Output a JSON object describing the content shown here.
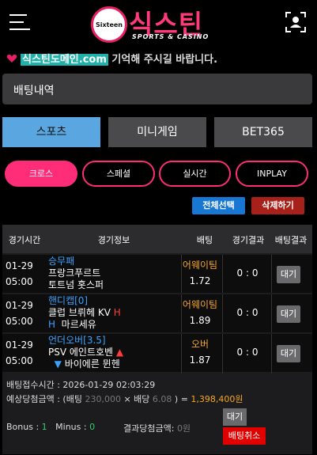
{
  "header": {
    "logo_circle_text": "Sixteen",
    "logo_main": "식스틴",
    "logo_sub": "SPORTS & CASINO"
  },
  "notice": {
    "domain": "식스틴도메인.com",
    "text": " 기억해 주시길 바랍니다."
  },
  "page_title": "배팅내역",
  "tabs": [
    {
      "label": "스포츠"
    },
    {
      "label": "미니게임"
    },
    {
      "label": "BET365"
    }
  ],
  "filters": [
    {
      "label": "크로스"
    },
    {
      "label": "스페셜"
    },
    {
      "label": "실시간"
    },
    {
      "label": "INPLAY"
    }
  ],
  "actions": {
    "select_all": "전체선택",
    "delete": "삭제하기"
  },
  "table": {
    "headers": [
      "경기시간",
      "경기정보",
      "배팅",
      "경기결과",
      "배팅결과"
    ],
    "rows": [
      {
        "date": "01-29",
        "time": "05:00",
        "bet_type": "승무패",
        "home": "프랑크푸르트",
        "away": "토트넘 홋스퍼",
        "home_marker": "",
        "away_marker": "",
        "pick": "어웨이팀",
        "odds": "1.72",
        "score": "0 : 0",
        "status": "대기"
      },
      {
        "date": "01-29",
        "time": "05:00",
        "bet_type": "핸디캡[0]",
        "home": "클럽 브뤼헤 KV",
        "away": "마르세유",
        "home_marker": "H",
        "away_marker": "H",
        "pick": "어웨이팀",
        "odds": "1.89",
        "score": "0 : 0",
        "status": "대기"
      },
      {
        "date": "01-29",
        "time": "05:00",
        "bet_type": "언더오버[3.5]",
        "home": "PSV 에인트호벤",
        "away": "바이에른 뮌헨",
        "home_marker": "▲",
        "away_marker": "▼",
        "pick": "오버",
        "odds": "1.87",
        "score": "0 : 0",
        "status": "대기"
      }
    ]
  },
  "summary": {
    "bet_time_label": "배팅접수시간 : ",
    "bet_time": "2026-01-29 02:03:29",
    "expected_label": "예상당첨금액 : (배팅 ",
    "bet_amount": "230,000",
    "times": " × 배당 ",
    "odds_total": "6.08",
    "equals": " ) = ",
    "expected_amount": "1,398,400원",
    "bonus_label": "Bonus : ",
    "bonus": "1",
    "minus_label": "Minus : ",
    "minus": "0",
    "result_label": "결과당첨금액: ",
    "result": "0원",
    "status": "대기",
    "cancel": "배팅취소"
  },
  "colors": {
    "accent_pink": "#ff2d78",
    "tab_active": "#5aa6e0",
    "select_all": "#1877d2",
    "delete": "#a8201a",
    "pick_orange": "#f5a623",
    "cancel_red": "#e00000"
  }
}
